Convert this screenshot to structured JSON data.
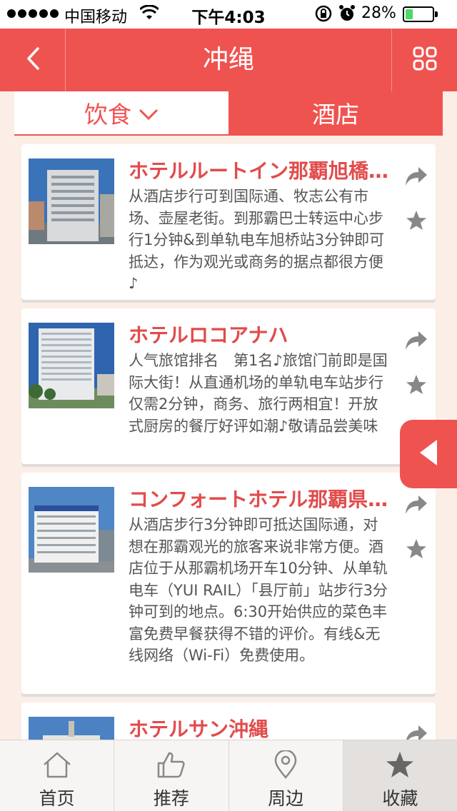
{
  "status_bar": {
    "carrier": "中国移动",
    "time": "下午4:03",
    "battery_pct": "28%",
    "battery_level": 0.28
  },
  "nav": {
    "title": "冲绳",
    "back_icon": "chevron-left-icon",
    "menu_icon": "grid-icon"
  },
  "tabs": [
    {
      "label": "饮食",
      "icon": "chevron-down-icon",
      "active": false
    },
    {
      "label": "酒店",
      "active": true
    }
  ],
  "hotels": [
    {
      "name": "ホテルルートイン那覇旭橋駅東",
      "desc": "从酒店步行可到国际通、牧志公有市场、壶屋老街。到那霸巴士转运中心步行1分钟&到单轨电车旭桥站3分钟即可抵达，作为观光或商务的据点都很方便♪"
    },
    {
      "name": "ホテルロコアナハ",
      "desc": "人气旅馆排名　第1名♪旅馆门前即是国际大街！从直通机场的单轨电车站步行仅需2分钟，商务、旅行两相宜！开放式厨房的餐厅好评如潮♪敬请品尝美味"
    },
    {
      "name": "コンフォートホテル那覇県庁前",
      "desc": "从酒店步行3分钟即可抵达国际通，对想在那霸观光的旅客来说非常方便。酒店位于从那霸机场开车10分钟、从单轨电车（YUI RAIL）「县厅前」站步行3分钟可到的地点。6:30开始供应的菜色丰富免费早餐获得不错的评价。有线&无线网络（Wi-Fi）免费使用。"
    },
    {
      "name": "ホテルサン沖縄",
      "desc": ""
    }
  ],
  "tabbar": [
    {
      "label": "首页",
      "icon": "home-icon"
    },
    {
      "label": "推荐",
      "icon": "thumbs-up-icon"
    },
    {
      "label": "周边",
      "icon": "location-pin-icon"
    },
    {
      "label": "收藏",
      "icon": "star-icon",
      "active": true
    }
  ]
}
